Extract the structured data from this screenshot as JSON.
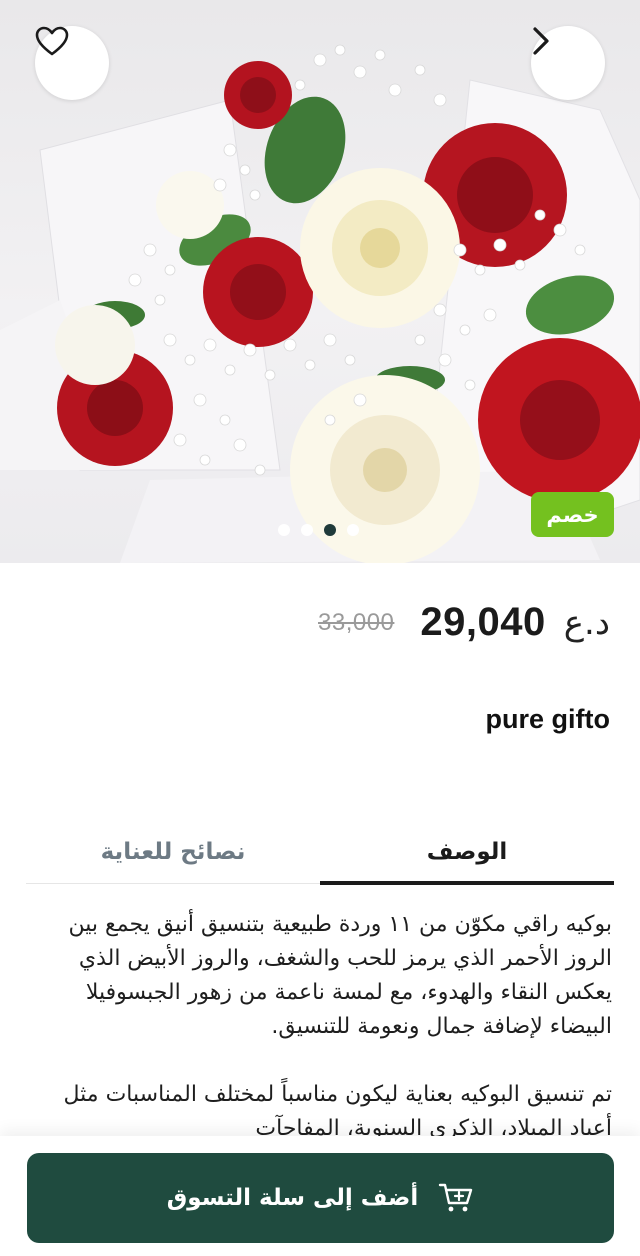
{
  "hero": {
    "discount_badge": "خصم",
    "carousel_count": 4,
    "carousel_active_index": 2,
    "icons": {
      "favorite": "heart-outline-icon",
      "next": "chevron-right-icon"
    }
  },
  "price": {
    "old": "33,000",
    "current": "29,040",
    "currency": "د.ع"
  },
  "brand": "pure gifto",
  "tabs": {
    "description": "الوصف",
    "care_tips": "نصائح للعناية",
    "active": "description"
  },
  "description": {
    "paragraph_1": "بوكيه راقي مكوّن من ١١ وردة طبيعية بتنسيق أنيق يجمع بين الروز الأحمر الذي يرمز للحب والشغف، والروز الأبيض الذي يعكس النقاء والهدوء، مع لمسة ناعمة من زهور الجبسوفيلا البيضاء لإضافة جمال ونعومة للتنسيق.",
    "paragraph_2": "تم تنسيق البوكيه بعناية ليكون مناسباً لمختلف المناسبات مثل أعياد الميلاد، الذكرى السنوية، المفاجآت"
  },
  "cart_button": {
    "label": "أضف إلى سلة التسوق",
    "icon": "cart-plus-icon"
  },
  "colors": {
    "primary": "#1f4b3f",
    "badge": "#74c11f",
    "active_dot": "#1f3a3a",
    "muted_tab": "#6d7a84"
  }
}
